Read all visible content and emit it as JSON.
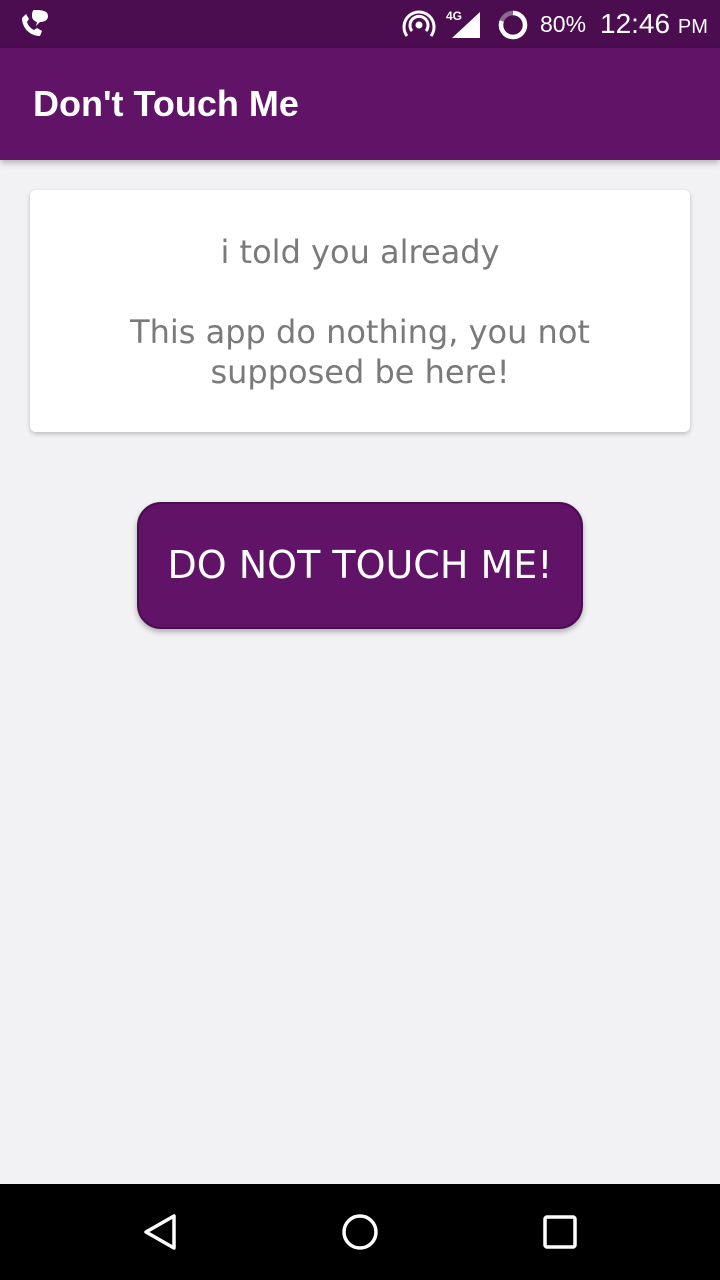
{
  "status_bar": {
    "network_type": "4G",
    "battery_percent": "80%",
    "time": "12:46",
    "time_suffix": "PM",
    "icons": [
      "wifi-calling-icon",
      "hotspot-icon",
      "signal-4g-icon",
      "battery-ring-icon"
    ]
  },
  "app_bar": {
    "title": "Don't Touch Me"
  },
  "card": {
    "line1": "i told you already",
    "line2": "This app do nothing, you not supposed be here!"
  },
  "button": {
    "label": "DO NOT TOUCH ME!"
  },
  "nav_bar": {
    "icons": [
      "back-icon",
      "home-icon",
      "recents-icon"
    ]
  },
  "colors": {
    "primary": "#601367",
    "primary_dark": "#4b0c50",
    "background": "#f2f1f3",
    "card_text": "#7a7a7a"
  }
}
